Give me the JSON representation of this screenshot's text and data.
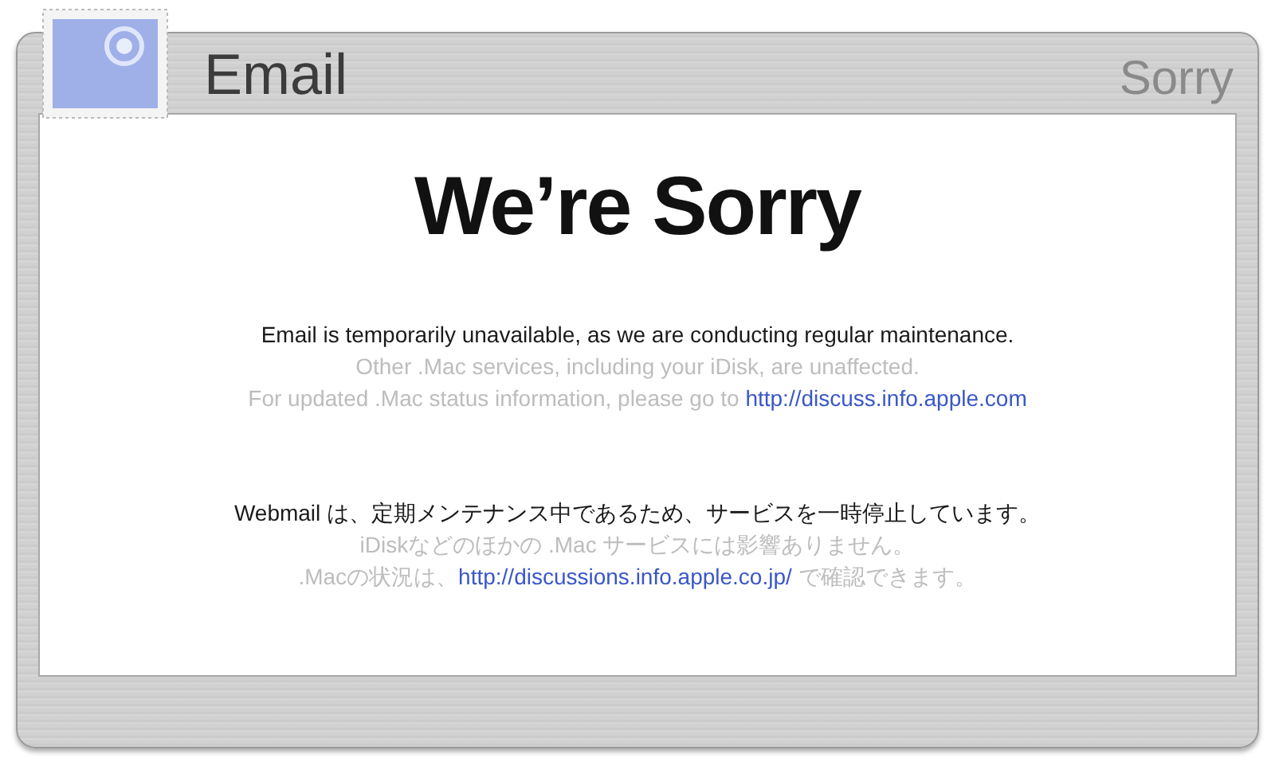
{
  "header": {
    "title": "Email",
    "section": "Sorry"
  },
  "heading": "We’re Sorry",
  "paragraphs": [
    {
      "lines": [
        {
          "kind": "primary",
          "text": "Email is temporarily unavailable, as we are conducting regular maintenance."
        },
        {
          "kind": "secondary",
          "text": "Other .Mac services, including your iDisk, are unaffected."
        },
        {
          "kind": "secondary",
          "text": "For updated .Mac status information, please go to ",
          "link": "http://discuss.info.apple.com"
        }
      ]
    },
    {
      "lines": [
        {
          "kind": "primary",
          "text": "Webmail は、定期メンテナンス中であるため、サービスを一時停止しています。"
        },
        {
          "kind": "secondary",
          "text": "iDiskなどのほかの .Mac サービスには影響ありません。"
        },
        {
          "kind": "secondary",
          "text": ".Macの状況は、",
          "link": "http://discussions.info.apple.co.jp/",
          "after": " で確認できます。"
        }
      ]
    }
  ]
}
